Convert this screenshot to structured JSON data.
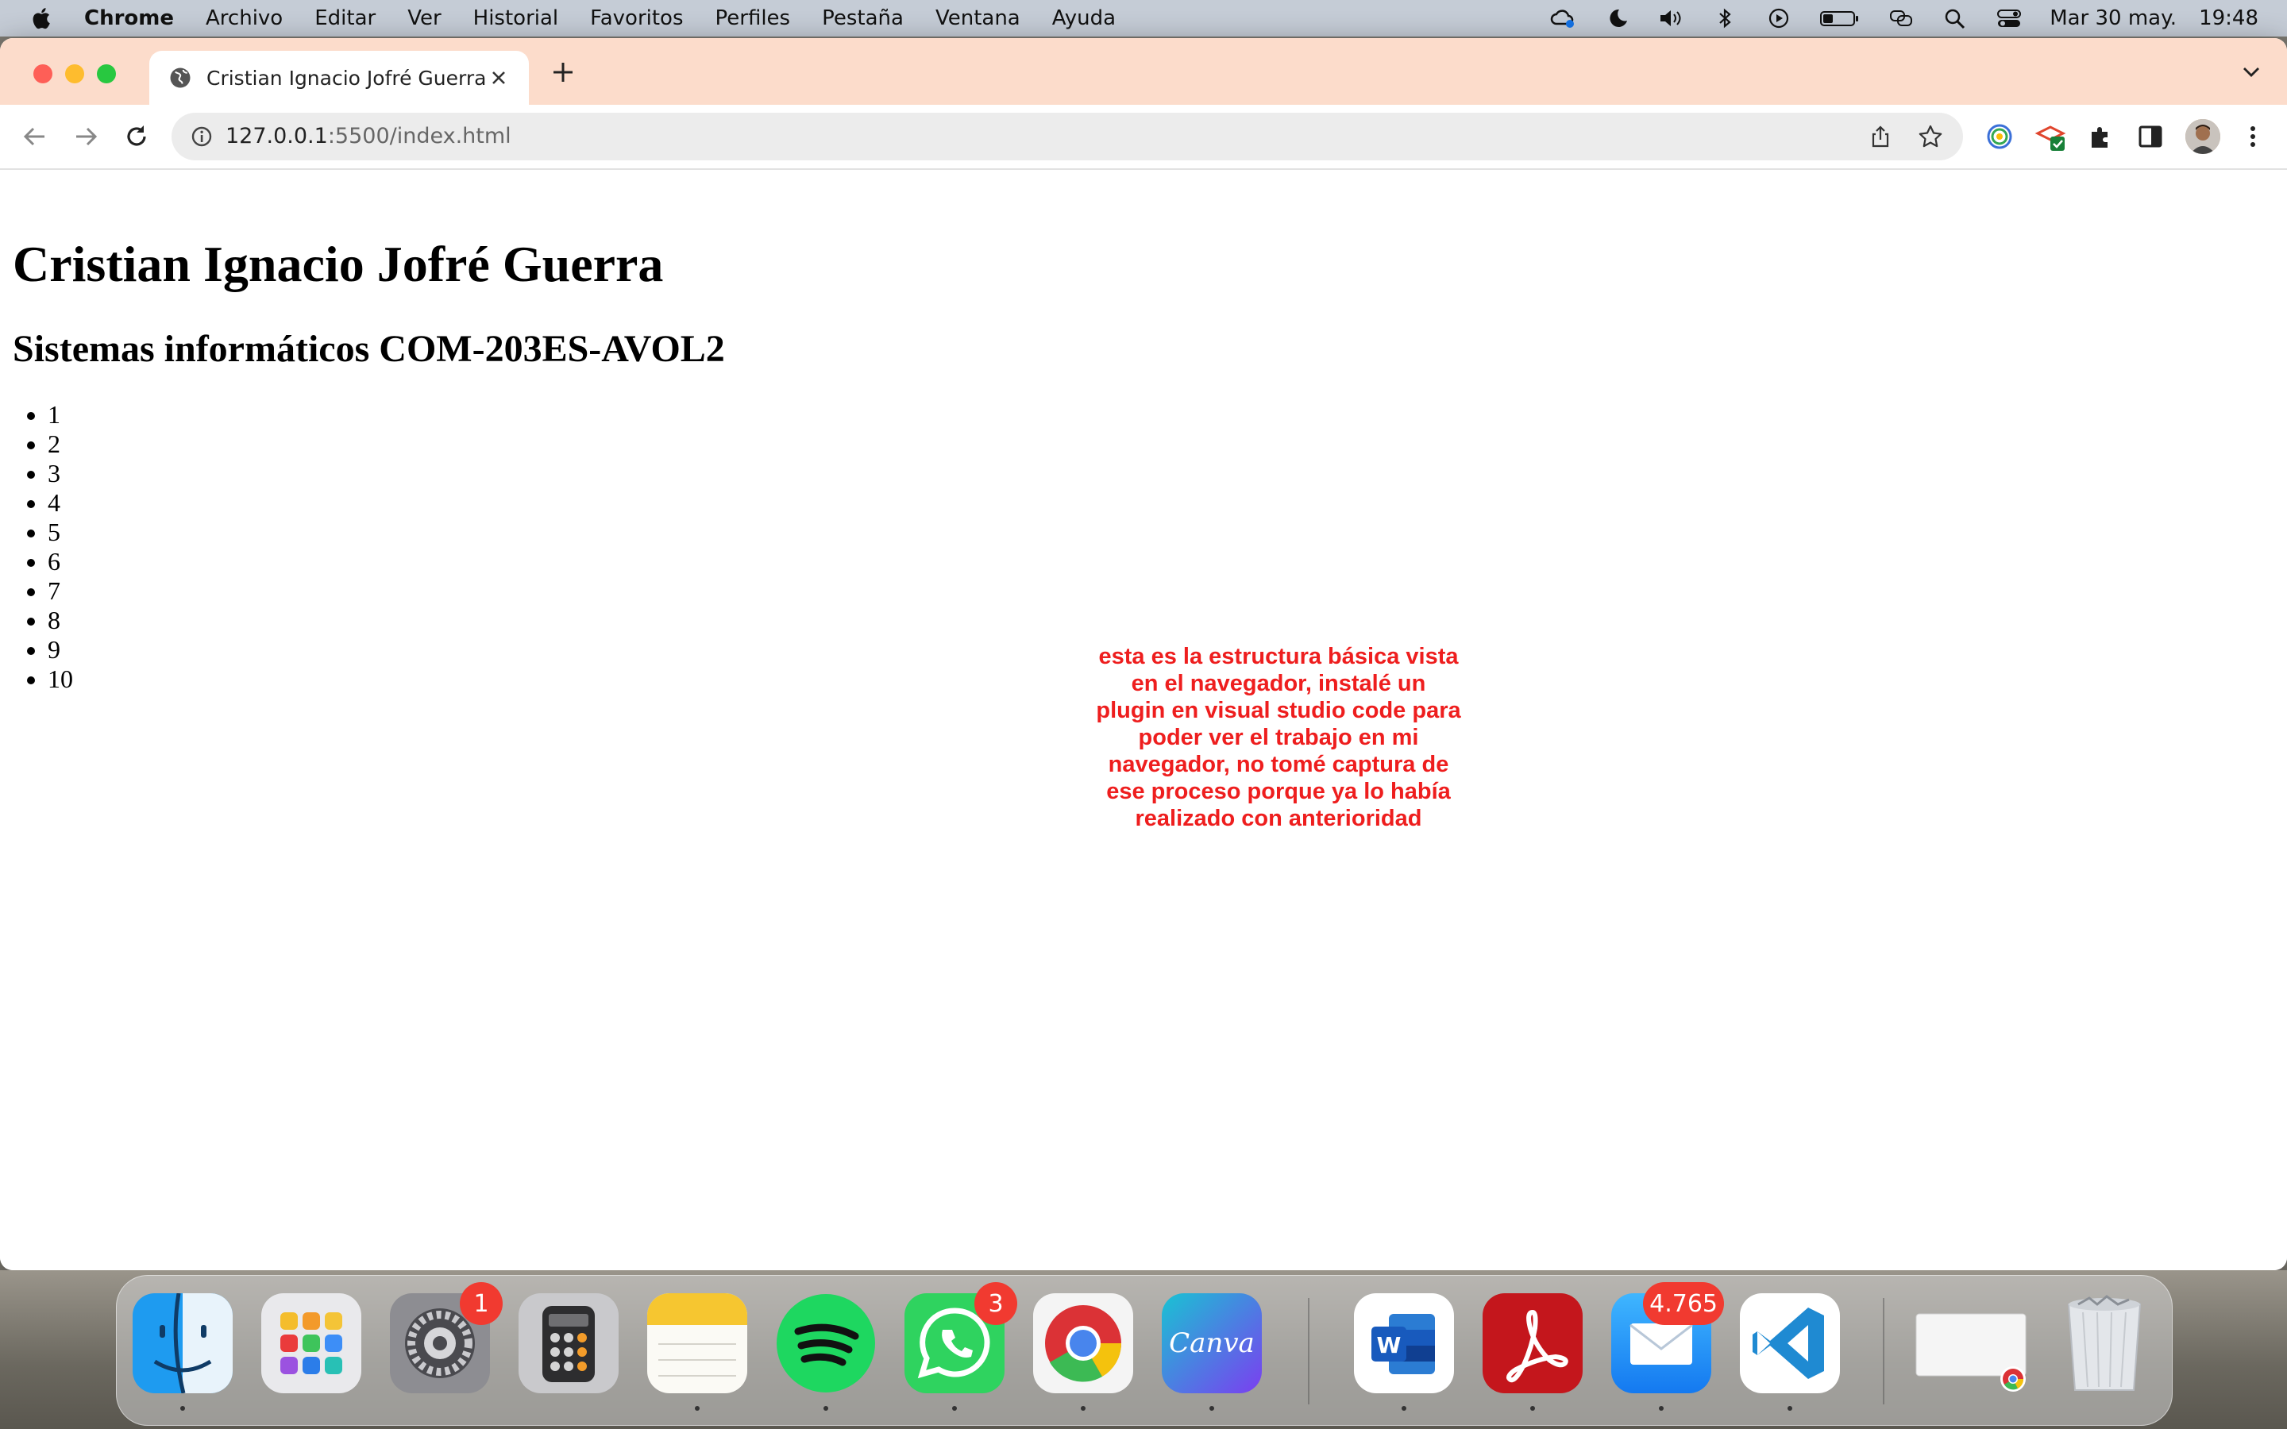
{
  "menubar": {
    "app_name": "Chrome",
    "items": [
      "Archivo",
      "Editar",
      "Ver",
      "Historial",
      "Favoritos",
      "Perfiles",
      "Pestaña",
      "Ventana",
      "Ayuda"
    ],
    "date": "Mar 30 may.",
    "time": "19:48"
  },
  "browser": {
    "tab_title": "Cristian Ignacio Jofré Guerra",
    "url_host": "127.0.0.1",
    "url_path": ":5500/index.html"
  },
  "page": {
    "h1": "Cristian Ignacio Jofré Guerra",
    "h2": "Sistemas informáticos COM-203ES-AVOL2",
    "list": [
      "1",
      "2",
      "3",
      "4",
      "5",
      "6",
      "7",
      "8",
      "9",
      "10"
    ],
    "annotation": "esta es la estructura básica vista en el navegador, instalé un plugin en visual studio code para poder ver el trabajo en mi navegador, no tomé captura de ese proceso porque ya lo había realizado con anterioridad",
    "annotation_color": "#ee1e1e"
  },
  "dock": {
    "items": [
      {
        "name": "Finder",
        "icon": "finder-icon"
      },
      {
        "name": "Launchpad",
        "icon": "launchpad-icon"
      },
      {
        "name": "Configuración del Sistema",
        "icon": "settings-icon",
        "badge": "1"
      },
      {
        "name": "Calculadora",
        "icon": "calculator-icon"
      },
      {
        "name": "Notas",
        "icon": "notes-icon"
      },
      {
        "name": "Spotify",
        "icon": "spotify-icon"
      },
      {
        "name": "WhatsApp",
        "icon": "whatsapp-icon",
        "badge": "3"
      },
      {
        "name": "Google Chrome",
        "icon": "chrome-icon"
      },
      {
        "name": "Canva",
        "icon": "canva-icon",
        "label": "Canva"
      },
      {
        "name": "Microsoft Word",
        "icon": "word-icon",
        "label": "W"
      },
      {
        "name": "Adobe Acrobat",
        "icon": "acrobat-icon"
      },
      {
        "name": "Mail",
        "icon": "mail-icon",
        "badge": "4.765"
      },
      {
        "name": "Visual Studio Code",
        "icon": "vscode-icon"
      },
      {
        "name": "Ventana minimizada",
        "icon": "minimized-window-icon"
      },
      {
        "name": "Papelera",
        "icon": "trash-icon"
      }
    ]
  }
}
